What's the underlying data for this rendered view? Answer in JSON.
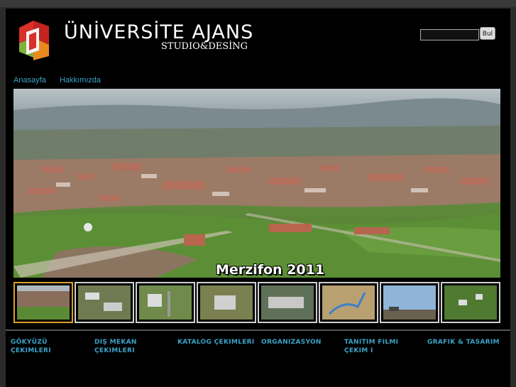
{
  "brand": {
    "title": "ÜNİVERSİTE AJANS",
    "subtitle": "STUDIO&DESİNG",
    "colors": {
      "red": "#d9302a",
      "green": "#7fb23a",
      "orange": "#e88a1e"
    }
  },
  "search": {
    "value": "",
    "button_label": "Bul"
  },
  "nav": {
    "items": [
      "Anasayfa",
      "Hakkımızda"
    ]
  },
  "hero": {
    "caption": "Merzifon 2011"
  },
  "thumbnails": [
    {
      "name": "thumb-1",
      "active": true
    },
    {
      "name": "thumb-2",
      "active": false
    },
    {
      "name": "thumb-3",
      "active": false
    },
    {
      "name": "thumb-4",
      "active": false
    },
    {
      "name": "thumb-5",
      "active": false
    },
    {
      "name": "thumb-6",
      "active": false
    },
    {
      "name": "thumb-7",
      "active": false
    },
    {
      "name": "thumb-8",
      "active": false
    }
  ],
  "footer_menu": [
    {
      "label": "GÖKYÜZÜ ÇEKIMLERI"
    },
    {
      "label": "DIŞ MEKAN ÇEKIMLERI"
    },
    {
      "label": "KATALOG ÇEKIMLERI"
    },
    {
      "label": "ORGANIZASYON"
    },
    {
      "label": "TANITIM FILMI ÇEKIM I"
    },
    {
      "label": "GRAFIK & TASARIM"
    }
  ],
  "accent_color": "#3aa3c8"
}
